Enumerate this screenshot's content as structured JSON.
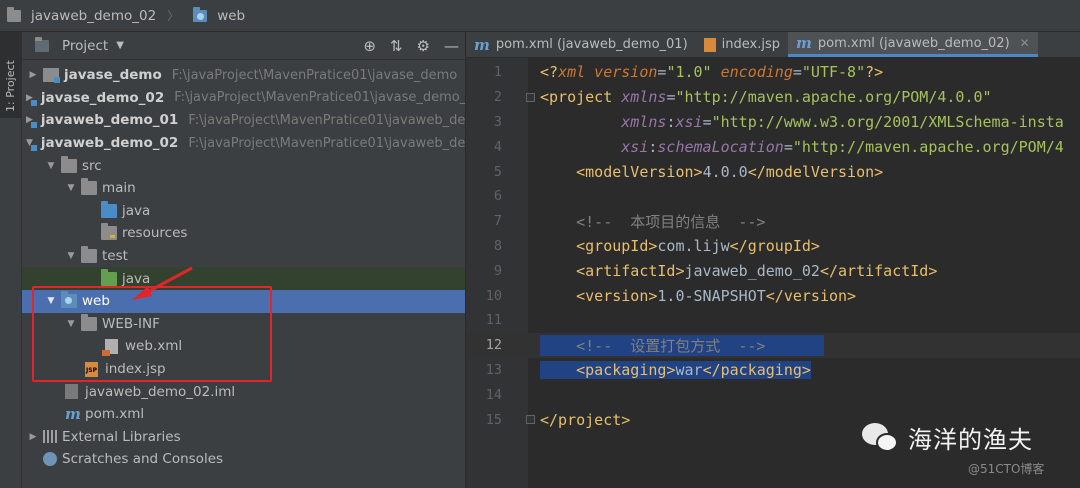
{
  "breadcrumb": {
    "project": "javaweb_demo_02",
    "folder": "web"
  },
  "toolstrip": {
    "tab_label": "1: Project"
  },
  "project_panel": {
    "title": "Project",
    "tree": [
      {
        "label": "javase_demo",
        "path": "F:\\javaProject\\MavenPratice01\\javase_demo",
        "bold": true
      },
      {
        "label": "javase_demo_02",
        "path": "F:\\javaProject\\MavenPratice01\\javase_demo_0",
        "bold": true
      },
      {
        "label": "javaweb_demo_01",
        "path": "F:\\javaProject\\MavenPratice01\\javaweb_der",
        "bold": true
      },
      {
        "label": "javaweb_demo_02",
        "path": "F:\\javaProject\\MavenPratice01\\javaweb_der",
        "bold": true
      },
      {
        "label": "src"
      },
      {
        "label": "main"
      },
      {
        "label": "java"
      },
      {
        "label": "resources"
      },
      {
        "label": "test"
      },
      {
        "label": "java"
      },
      {
        "label": "web"
      },
      {
        "label": "WEB-INF"
      },
      {
        "label": "web.xml"
      },
      {
        "label": "index.jsp"
      },
      {
        "label": "javaweb_demo_02.iml"
      },
      {
        "label": "pom.xml"
      },
      {
        "label": "External Libraries"
      },
      {
        "label": "Scratches and Consoles"
      }
    ]
  },
  "editor": {
    "tabs": [
      {
        "label": "pom.xml (javaweb_demo_01)",
        "icon": "maven-icon"
      },
      {
        "label": "index.jsp",
        "icon": "jsp-icon"
      },
      {
        "label": "pom.xml (javaweb_demo_02)",
        "icon": "maven-icon",
        "active": true
      }
    ],
    "line_numbers": [
      "1",
      "2",
      "3",
      "4",
      "5",
      "6",
      "7",
      "8",
      "9",
      "10",
      "11",
      "12",
      "13",
      "14",
      "15"
    ],
    "current_line": 12
  },
  "watermark": {
    "name": "海洋的渔夫",
    "site": "@51CTO博客"
  },
  "colors": {
    "selection": "#4b6eaf",
    "annotation_box": "#e0262b",
    "tab_underline": "#4a88c7"
  }
}
